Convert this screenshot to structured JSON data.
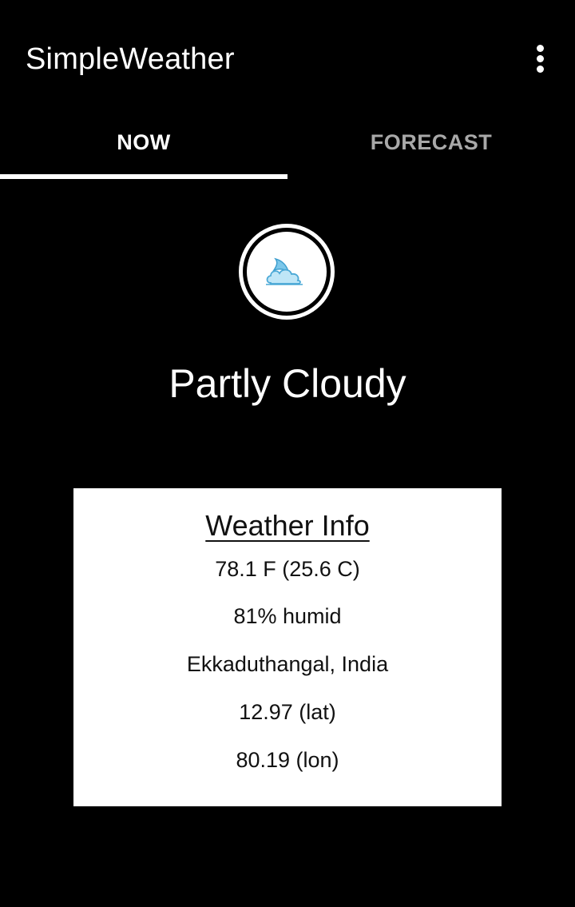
{
  "app_bar": {
    "title": "SimpleWeather",
    "menu_icon": "more-vert-icon"
  },
  "tabs": [
    {
      "label": "NOW",
      "selected": true
    },
    {
      "label": "FORECAST",
      "selected": false
    }
  ],
  "current": {
    "icon": "partly-cloudy-night-icon",
    "condition": "Partly Cloudy"
  },
  "info": {
    "heading": "Weather Info",
    "temperature": "78.1 F (25.6 C)",
    "humidity": "81% humid",
    "location": "Ekkaduthangal, India",
    "lat": "12.97 (lat)",
    "lon": "80.19 (lon)"
  },
  "colors": {
    "background": "#000000",
    "card": "#ffffff",
    "text_primary": "#ffffff",
    "tab_inactive": "#a8a8a8",
    "icon_cloud": "#8fd0ef"
  }
}
